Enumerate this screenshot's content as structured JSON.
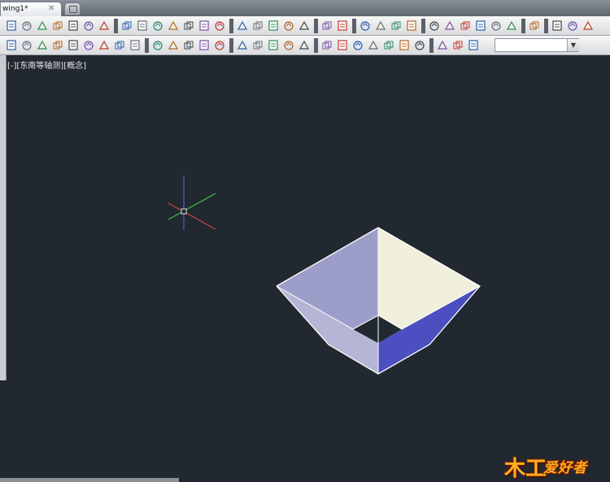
{
  "document_tab": {
    "label": "wing1*",
    "close_glyph": "✕"
  },
  "viewport": {
    "label": "[-][东南等轴测][概念]",
    "background_color": "#212830"
  },
  "model_colors": {
    "left_face": "#9c9dc8",
    "right_face": "#efefdc",
    "front_right_face": "#4b4fbf",
    "front_left_face": "#b5b6d6",
    "edge": "#ffffff"
  },
  "ucs_colors": {
    "x_axis": "#cc4444",
    "y_axis": "#44bb44",
    "z_axis": "#5a5ad8"
  },
  "toolbar_row1": {
    "icons": [
      "text-style-icon",
      "find-text-icon",
      "spell-check-icon",
      "text-edit-icon",
      "scale-text-icon",
      "justify-text-icon",
      "mtext-icon",
      "new-icon",
      "open-icon",
      "save-icon",
      "plot-icon",
      "plot-preview-icon",
      "publish-icon",
      "3d-print-icon",
      "cut-icon",
      "copy-icon",
      "paste-icon",
      "match-properties-icon",
      "block-editor-icon",
      "undo-icon",
      "redo-icon",
      "pan-icon",
      "zoom-realtime-icon",
      "zoom-window-icon",
      "zoom-previous-icon",
      "properties-icon",
      "design-center-icon",
      "tool-palettes-icon",
      "sheet-set-icon",
      "markup-icon",
      "calculator-icon",
      "help-icon",
      "visual-style-wireframe-icon",
      "visual-style-hidden-icon",
      "visual-style-realistic-icon",
      "visual-style-conceptual-icon"
    ]
  },
  "toolbar_row2": {
    "icons": [
      "ucs-icon",
      "orbit-icon",
      "box-icon",
      "wedge-icon",
      "extrude-icon",
      "revolve-icon",
      "sweep-icon",
      "loft-icon",
      "union-icon",
      "subtract-icon",
      "intersect-icon",
      "slice-icon",
      "interfere-icon",
      "section-icon",
      "flatten-icon",
      "imprint-icon",
      "separate-icon",
      "shell-icon",
      "check-icon",
      "named-views-icon",
      "top-view-icon",
      "bottom-view-icon",
      "left-view-icon",
      "right-view-icon",
      "front-view-icon",
      "back-view-icon",
      "sw-iso-icon",
      "se-iso-icon",
      "ne-iso-icon",
      "nw-iso-icon",
      "camera-icon",
      "render-icon"
    ],
    "combo_value": ""
  },
  "watermark": {
    "text": "爱好者",
    "logo": "木工"
  }
}
